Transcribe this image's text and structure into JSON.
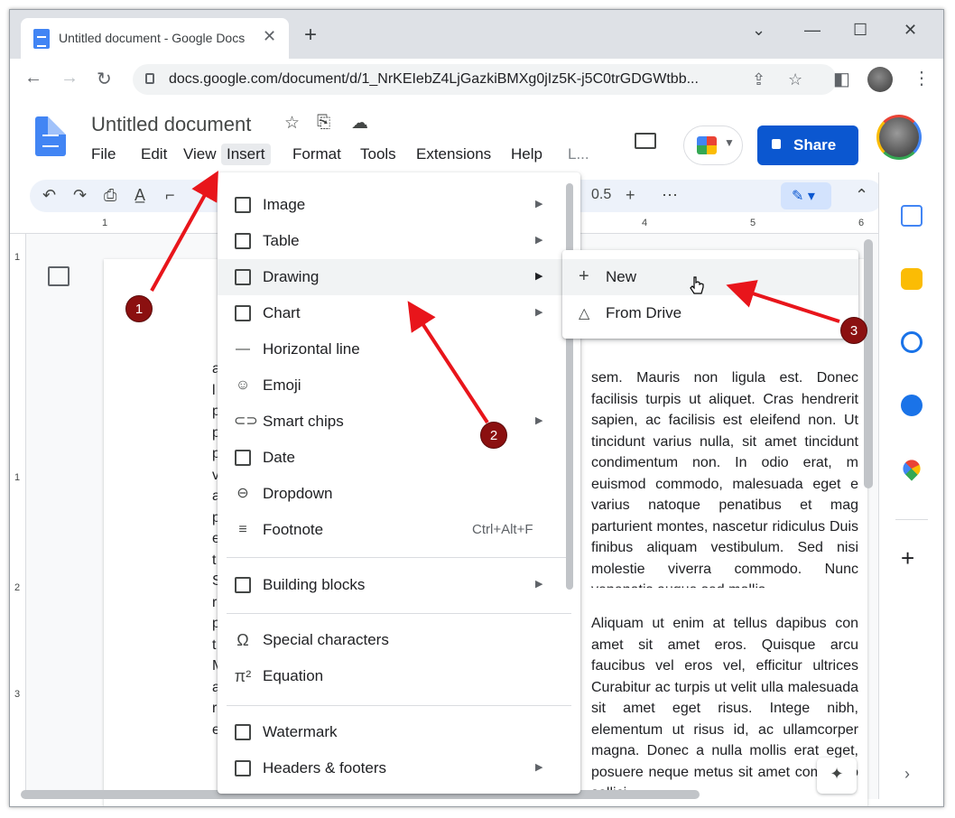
{
  "browser": {
    "tab_title": "Untitled document - Google Docs",
    "new_tab": "+",
    "url": "docs.google.com/document/d/1_NrKEIebZ4LjGazkiBMXg0jIz5K-j5C0trGDGWtbb...",
    "window_controls": [
      "minimize",
      "maximize",
      "close"
    ]
  },
  "docs": {
    "title": "Untitled document",
    "menus": [
      "File",
      "Edit",
      "View",
      "Insert",
      "Format",
      "Tools",
      "Extensions",
      "Help",
      "L..."
    ],
    "active_menu": "Insert",
    "share_label": "Share",
    "font_size": "0.5",
    "brand_color": "#0b57d0"
  },
  "ruler": {
    "top": [
      "1",
      "4",
      "5",
      "6"
    ],
    "left": [
      "1",
      "1",
      "2",
      "3"
    ]
  },
  "insert_menu": {
    "items": [
      {
        "label": "Image",
        "icon": "image-icon",
        "submenu": true
      },
      {
        "label": "Table",
        "icon": "table-icon",
        "submenu": true
      },
      {
        "label": "Drawing",
        "icon": "drawing-icon",
        "submenu": true
      },
      {
        "label": "Chart",
        "icon": "chart-icon",
        "submenu": true
      },
      {
        "label": "Horizontal line",
        "icon": "horizontal-line-icon",
        "submenu": false
      },
      {
        "label": "Emoji",
        "icon": "emoji-icon",
        "submenu": false
      },
      {
        "label": "Smart chips",
        "icon": "smart-chips-icon",
        "submenu": true
      },
      {
        "label": "Date",
        "icon": "date-icon",
        "submenu": false
      },
      {
        "label": "Dropdown",
        "icon": "dropdown-icon",
        "submenu": false
      },
      {
        "label": "Footnote",
        "icon": "footnote-icon",
        "shortcut": "Ctrl+Alt+F"
      },
      {
        "label": "Building blocks",
        "icon": "building-blocks-icon",
        "submenu": true
      },
      {
        "label": "Special characters",
        "icon": "omega-icon",
        "submenu": false
      },
      {
        "label": "Equation",
        "icon": "pi-icon",
        "submenu": false
      },
      {
        "label": "Watermark",
        "icon": "watermark-icon",
        "submenu": false
      },
      {
        "label": "Headers & footers",
        "icon": "headers-footers-icon",
        "submenu": true
      }
    ]
  },
  "drawing_submenu": {
    "items": [
      {
        "label": "New",
        "icon": "plus-icon"
      },
      {
        "label": "From Drive",
        "icon": "drive-icon"
      }
    ]
  },
  "document": {
    "paragraph1": "sem. Mauris non ligula est. Donec facilisis turpis ut aliquet. Cras hendrerit sapien, ac facilisis est eleifend non. Ut tincidunt varius nulla, sit amet tincidunt condimentum non. In odio erat, m euismod commodo, malesuada eget e varius natoque penatibus et mag parturient montes, nascetur ridiculus Duis finibus aliquam vestibulum. Sed nisi molestie viverra commodo. Nunc venenatis augue sed mollis.",
    "paragraph2": "Aliquam ut enim at tellus dapibus con amet sit amet eros. Quisque arcu faucibus vel eros vel, efficitur ultrices Curabitur ac turpis ut velit ulla malesuada sit amet eget risus. Intege nibh, elementum ut risus id, ac ullamcorper magna. Donec a nulla mollis erat eget, posuere neque metus sit amet commodo sollici",
    "left_column_letters": "a l p p p v a p e t S r p t M a r e"
  },
  "annotations": [
    "1",
    "2",
    "3"
  ],
  "annotation_color": "#e8151b"
}
